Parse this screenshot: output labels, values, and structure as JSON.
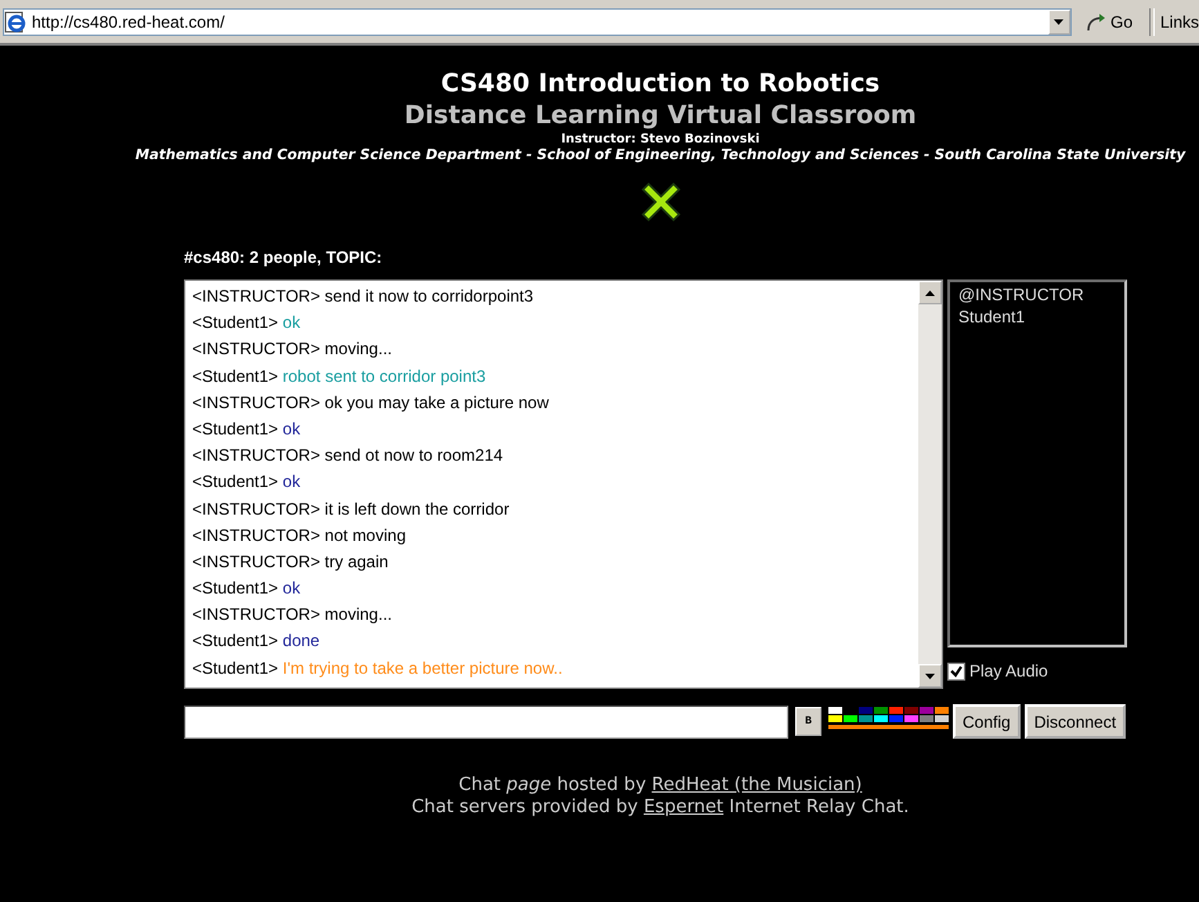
{
  "browser": {
    "address": "http://cs480.red-heat.com/",
    "go_label": "Go",
    "links_label": "Links"
  },
  "header": {
    "title": "CS480 Introduction to Robotics",
    "subtitle": "Distance Learning Virtual Classroom",
    "instructor": "Instructor: Stevo Bozinovski",
    "department": "Mathematics and Computer Science Department - School of Engineering, Technology and Sciences - South Carolina State University"
  },
  "channel_status": "#cs480: 2 people, TOPIC:",
  "messages": [
    {
      "nick": "<INSTRUCTOR>",
      "text": "send it now to corridorpoint3",
      "color": "#000000"
    },
    {
      "nick": "<Student1>",
      "text": "ok",
      "color": "#199ea0"
    },
    {
      "nick": "<INSTRUCTOR>",
      "text": "moving...",
      "color": "#000000"
    },
    {
      "nick": "<Student1>",
      "text": "robot sent to corridor point3",
      "color": "#199ea0"
    },
    {
      "nick": "<INSTRUCTOR>",
      "text": "ok you may take a picture now",
      "color": "#000000"
    },
    {
      "nick": "<Student1>",
      "text": "ok",
      "color": "#23289a"
    },
    {
      "nick": "<INSTRUCTOR>",
      "text": "send ot now to room214",
      "color": "#000000"
    },
    {
      "nick": "<Student1>",
      "text": "ok",
      "color": "#23289a"
    },
    {
      "nick": "<INSTRUCTOR>",
      "text": "it is left down the corridor",
      "color": "#000000"
    },
    {
      "nick": "<INSTRUCTOR>",
      "text": "not moving",
      "color": "#000000"
    },
    {
      "nick": "<INSTRUCTOR>",
      "text": "try again",
      "color": "#000000"
    },
    {
      "nick": "<Student1>",
      "text": "ok",
      "color": "#23289a"
    },
    {
      "nick": "<INSTRUCTOR>",
      "text": "moving...",
      "color": "#000000"
    },
    {
      "nick": "<Student1>",
      "text": "done",
      "color": "#23289a"
    },
    {
      "nick": "<Student1>",
      "text": "I'm trying to take a better picture now..",
      "color": "#ff8c1a"
    }
  ],
  "users": [
    {
      "name": "@INSTRUCTOR"
    },
    {
      "name": "Student1"
    }
  ],
  "play_audio": {
    "label": "Play Audio",
    "checked": true
  },
  "bold_button": "B",
  "palette": [
    {
      "color": "#ffffff"
    },
    {
      "color": "#000000"
    },
    {
      "color": "#00007f"
    },
    {
      "color": "#009300"
    },
    {
      "color": "#ff2000"
    },
    {
      "color": "#7f0000"
    },
    {
      "color": "#9c009c"
    },
    {
      "color": "#fc7f00"
    },
    {
      "color": "#ffff00"
    },
    {
      "color": "#00fc00"
    },
    {
      "color": "#009393"
    },
    {
      "color": "#00ffff"
    },
    {
      "color": "#0020fc"
    },
    {
      "color": "#ff40ff"
    },
    {
      "color": "#7f7f7f"
    },
    {
      "color": "#d2d2d2"
    }
  ],
  "selected_color": {
    "color": "#fc7f00"
  },
  "buttons": [
    "Config",
    "Disconnect"
  ],
  "footer": [
    {
      "before": "Chat *page* hosted by",
      "link": "RedHeat (the Musician)"
    },
    {
      "before": "Chat servers provided by",
      "link": "Espernet",
      "after": "Internet Relay Chat."
    }
  ]
}
